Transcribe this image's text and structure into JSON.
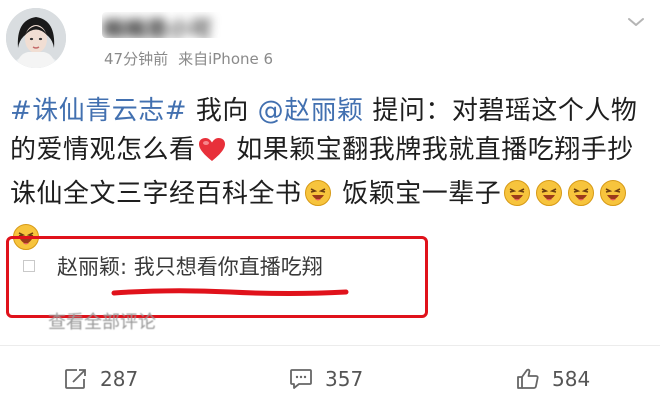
{
  "post": {
    "username": "楠楠是小可",
    "time": "47分钟前",
    "source": "来自iPhone 6"
  },
  "content": {
    "topic": "#诛仙青云志#",
    "part1": " 我向 ",
    "mention": "@赵丽颖",
    "part2": " 提问：对碧瑶这个人物的爱情观怎么看",
    "part3": " 如果颖宝翻我牌我就直播吃翔手抄诛仙全文三字经百科全书",
    "part4": " 饭颖宝一辈子"
  },
  "comment": {
    "author": "赵丽颖",
    "separator": ": ",
    "text": "我只想看你直播吃翔",
    "view_all": "查看全部评论"
  },
  "actions": {
    "repost_count": "287",
    "comment_count": "357",
    "like_count": "584"
  },
  "colors": {
    "link": "#4270b0",
    "highlight_box": "#e0121b",
    "heart": "#e8303a"
  },
  "icons": [
    "more-icon",
    "heart-icon",
    "laughing-emoji-icon",
    "repost-icon",
    "comment-icon",
    "like-icon"
  ]
}
